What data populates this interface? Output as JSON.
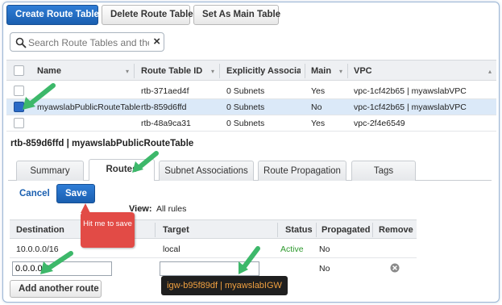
{
  "toolbar": {
    "create_label": "Create Route Table",
    "delete_label": "Delete Route Table",
    "set_main_label": "Set As Main Table"
  },
  "search": {
    "value": "Search Route Tables and thei",
    "clear_icon": "×"
  },
  "table": {
    "columns": [
      "Name",
      "Route Table ID",
      "Explicitly Associat",
      "Main",
      "VPC"
    ],
    "rows": [
      {
        "name": "",
        "id": "rtb-371aed4f",
        "assoc": "0 Subnets",
        "main": "Yes",
        "vpc": "vpc-1cf42b65 | myawslabVPC",
        "selected": false
      },
      {
        "name": "myawslabPublicRouteTable",
        "id": "rtb-859d6ffd",
        "assoc": "0 Subnets",
        "main": "No",
        "vpc": "vpc-1cf42b65 | myawslabVPC",
        "selected": true
      },
      {
        "name": "",
        "id": "rtb-48a9ca31",
        "assoc": "0 Subnets",
        "main": "Yes",
        "vpc": "vpc-2f4e6549",
        "selected": false
      }
    ]
  },
  "detail": {
    "title": "rtb-859d6ffd | myawslabPublicRouteTable",
    "tabs": [
      "Summary",
      "Routes",
      "Subnet Associations",
      "Route Propagation",
      "Tags"
    ],
    "active_tab": "Routes"
  },
  "routes": {
    "cancel_label": "Cancel",
    "save_label": "Save",
    "view_label": "View:",
    "view_value": "All rules",
    "columns": [
      "Destination",
      "Target",
      "Status",
      "Propagated",
      "Remove"
    ],
    "rows": [
      {
        "destination": "10.0.0.0/16",
        "target": "local",
        "status": "Active",
        "propagated": "No"
      }
    ],
    "new_row": {
      "destination": "0.0.0.0/0",
      "target": "",
      "propagated": "No"
    },
    "add_label": "Add another route"
  },
  "annotations": {
    "tooltip_text": "Hit me to save",
    "target_hint": "igw-b95f89df | myawslabIGW"
  },
  "colors": {
    "primary": "#1a5fb0",
    "active_status": "#2f9a2f",
    "arrow_green": "#3db86a",
    "tooltip_red": "#e24b46",
    "hint_orange": "#f0a040"
  }
}
